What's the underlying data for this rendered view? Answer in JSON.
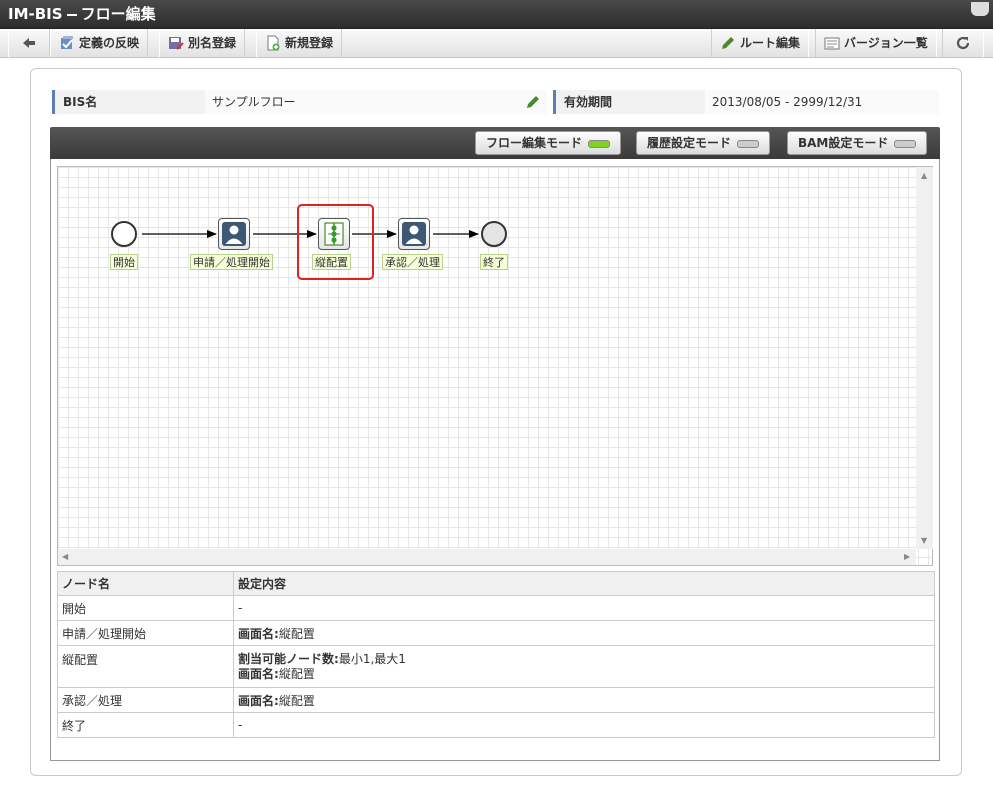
{
  "title": {
    "app": "IM-BIS",
    "page": "フロー編集"
  },
  "toolbar": {
    "reflect": "定義の反映",
    "save_as": "別名登録",
    "new": "新規登録",
    "route_edit": "ルート編集",
    "versions": "バージョン一覧"
  },
  "info": {
    "bis_name_label": "BIS名",
    "bis_name_value": "サンプルフロー",
    "period_label": "有効期間",
    "period_value": "2013/08/05 - 2999/12/31"
  },
  "modes": [
    {
      "label": "フロー編集モード",
      "active": true,
      "led": "#7ed321"
    },
    {
      "label": "履歴設定モード",
      "active": false,
      "led": "#cccccc"
    },
    {
      "label": "BAM設定モード",
      "active": false,
      "led": "#cccccc"
    }
  ],
  "flow": {
    "nodes": [
      "開始",
      "申請／処理開始",
      "縦配置",
      "承認／処理",
      "終了"
    ],
    "selected_node": "縦配置"
  },
  "table": {
    "headers": [
      "ノード名",
      "設定内容"
    ],
    "rows": [
      {
        "name": "開始",
        "lines": [
          {
            "key": "",
            "value": "-"
          }
        ]
      },
      {
        "name": "申請／処理開始",
        "lines": [
          {
            "key": "画面名:",
            "value": "縦配置"
          }
        ]
      },
      {
        "name": "縦配置",
        "lines": [
          {
            "key": "割当可能ノード数:",
            "value": "最小1,最大1"
          },
          {
            "key": "画面名:",
            "value": "縦配置"
          }
        ]
      },
      {
        "name": "承認／処理",
        "lines": [
          {
            "key": "画面名:",
            "value": "縦配置"
          }
        ]
      },
      {
        "name": "終了",
        "lines": [
          {
            "key": "",
            "value": "-"
          }
        ]
      }
    ]
  },
  "colors": {
    "accent": "#5b7fb0",
    "selection": "#dd2222",
    "led_on": "#7ed321"
  }
}
